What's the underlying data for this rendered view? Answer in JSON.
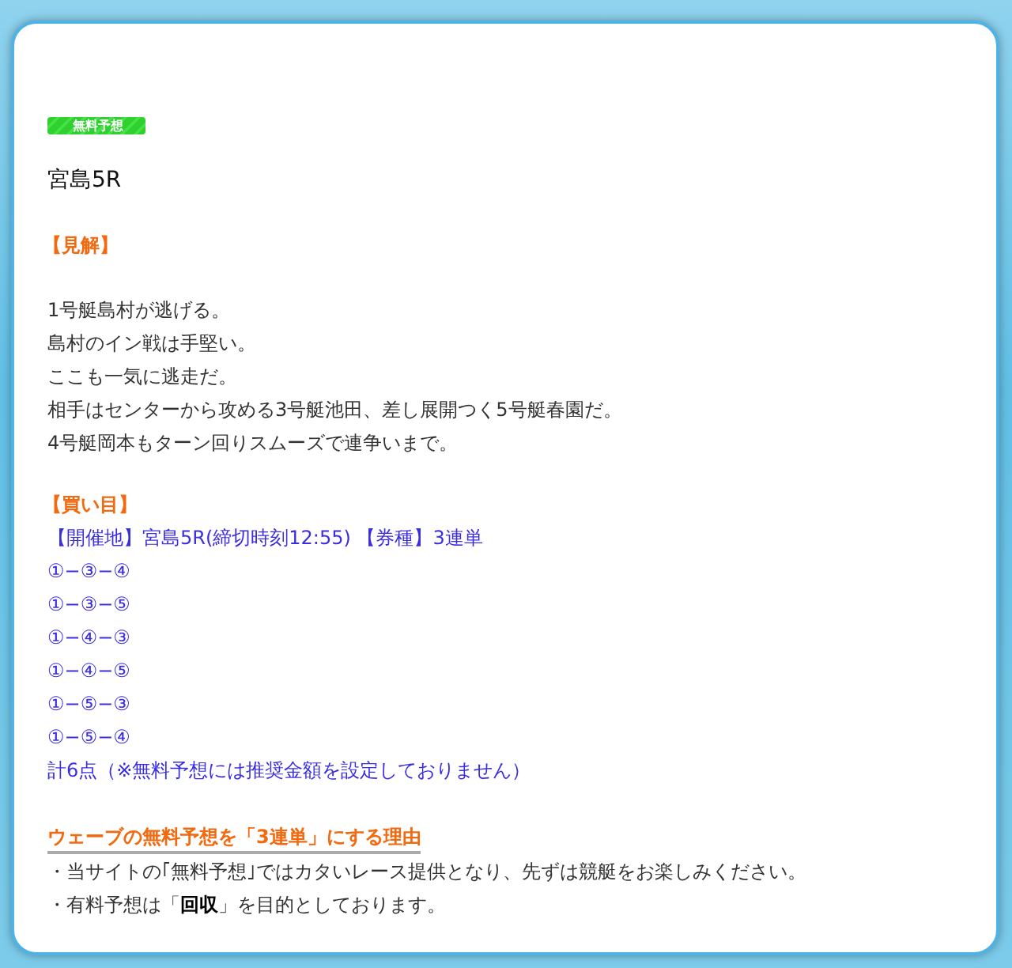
{
  "badge": "無料予想",
  "title": "宮島5R",
  "sections": [
    {
      "kind": "analysis",
      "heading": "【見解】",
      "lines": [
        "1号艇島村が逃げる。",
        "島村のイン戦は手堅い。",
        "ここも一気に逃走だ。",
        "相手はセンターから攻める3号艇池田、差し展開つく5号艇春園だ。",
        "4号艇岡本もターン回りスムーズで連争いまで。"
      ]
    },
    {
      "kind": "picks",
      "heading": "【買い目】",
      "lines": [
        "【開催地】宮島5R(締切時刻12:55) 【券種】3連単",
        "①−③−④",
        "①−③−⑤",
        "①−④−③",
        "①−④−⑤",
        "①−⑤−③",
        "①−⑤−④",
        "計6点（※無料予想には推奨金額を設定しておりません）"
      ]
    },
    {
      "kind": "reason",
      "heading": "ウェーブの無料予想を「3連単」にする理由",
      "lines": [
        "・当サイトの｢無料予想｣ではカタいレース提供となり、先ずは競艇をお楽しみください。",
        "・有料予想は「**回収**」を目的としております。"
      ]
    }
  ]
}
